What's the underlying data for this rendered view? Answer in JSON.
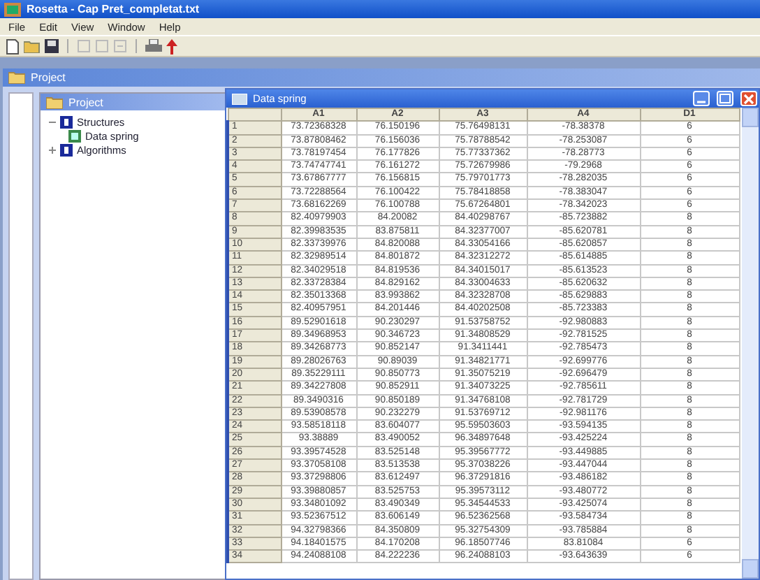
{
  "window": {
    "title": "Rosetta - Cap Pret_completat.txt"
  },
  "menu": [
    "File",
    "Edit",
    "View",
    "Window",
    "Help"
  ],
  "project_frame": {
    "title": "Project"
  },
  "project_tree": {
    "title": "Project",
    "items": [
      {
        "label": "Structures",
        "expanded": true,
        "children": [
          {
            "label": "Data spring"
          }
        ]
      },
      {
        "label": "Algorithms",
        "expanded": false
      }
    ]
  },
  "data_window": {
    "title": "Data spring"
  },
  "table": {
    "columns": [
      "A1",
      "A2",
      "A3",
      "A4",
      "D1"
    ],
    "rows": [
      {
        "index": "1",
        "cells": [
          "73.72368328",
          "76.150196",
          "75.76498131",
          "-78.38378",
          "6"
        ]
      },
      {
        "index": "2",
        "cells": [
          "73.87808462",
          "76.156036",
          "75.78788542",
          "-78.253087",
          "6"
        ]
      },
      {
        "index": "3",
        "cells": [
          "73.78197454",
          "76.177826",
          "75.77337362",
          "-78.28773",
          "6"
        ]
      },
      {
        "index": "4",
        "cells": [
          "73.74747741",
          "76.161272",
          "75.72679986",
          "-79.2968",
          "6"
        ]
      },
      {
        "index": "5",
        "cells": [
          "73.67867777",
          "76.156815",
          "75.79701773",
          "-78.282035",
          "6"
        ]
      },
      {
        "index": "6",
        "cells": [
          "73.72288564",
          "76.100422",
          "75.78418858",
          "-78.383047",
          "6"
        ]
      },
      {
        "index": "7",
        "cells": [
          "73.68162269",
          "76.100788",
          "75.67264801",
          "-78.342023",
          "6"
        ]
      },
      {
        "index": "8",
        "cells": [
          "82.40979903",
          "84.20082",
          "84.40298767",
          "-85.723882",
          "8"
        ]
      },
      {
        "index": "9",
        "cells": [
          "82.39983535",
          "83.875811",
          "84.32377007",
          "-85.620781",
          "8"
        ]
      },
      {
        "index": "10",
        "cells": [
          "82.33739976",
          "84.820088",
          "84.33054166",
          "-85.620857",
          "8"
        ]
      },
      {
        "index": "11",
        "cells": [
          "82.32989514",
          "84.801872",
          "84.32312272",
          "-85.614885",
          "8"
        ]
      },
      {
        "index": "12",
        "cells": [
          "82.34029518",
          "84.819536",
          "84.34015017",
          "-85.613523",
          "8"
        ]
      },
      {
        "index": "13",
        "cells": [
          "82.33728384",
          "84.829162",
          "84.33004633",
          "-85.620632",
          "8"
        ]
      },
      {
        "index": "14",
        "cells": [
          "82.35013368",
          "83.993862",
          "84.32328708",
          "-85.629883",
          "8"
        ]
      },
      {
        "index": "15",
        "cells": [
          "82.40957951",
          "84.201446",
          "84.40202508",
          "-85.723383",
          "8"
        ]
      },
      {
        "index": "16",
        "cells": [
          "89.52901618",
          "90.230297",
          "91.53758752",
          "-92.980883",
          "8"
        ]
      },
      {
        "index": "17",
        "cells": [
          "89.34968953",
          "90.346723",
          "91.34808529",
          "-92.781525",
          "8"
        ]
      },
      {
        "index": "18",
        "cells": [
          "89.34268773",
          "90.852147",
          "91.3411441",
          "-92.785473",
          "8"
        ]
      },
      {
        "index": "19",
        "cells": [
          "89.28026763",
          "90.89039",
          "91.34821771",
          "-92.699776",
          "8"
        ]
      },
      {
        "index": "20",
        "cells": [
          "89.35229111",
          "90.850773",
          "91.35075219",
          "-92.696479",
          "8"
        ]
      },
      {
        "index": "21",
        "cells": [
          "89.34227808",
          "90.852911",
          "91.34073225",
          "-92.785611",
          "8"
        ]
      },
      {
        "index": "22",
        "cells": [
          "89.3490316",
          "90.850189",
          "91.34768108",
          "-92.781729",
          "8"
        ]
      },
      {
        "index": "23",
        "cells": [
          "89.53908578",
          "90.232279",
          "91.53769712",
          "-92.981176",
          "8"
        ]
      },
      {
        "index": "24",
        "cells": [
          "93.58518118",
          "83.604077",
          "95.59503603",
          "-93.594135",
          "8"
        ]
      },
      {
        "index": "25",
        "cells": [
          "93.38889",
          "83.490052",
          "96.34897648",
          "-93.425224",
          "8"
        ]
      },
      {
        "index": "26",
        "cells": [
          "93.39574528",
          "83.525148",
          "95.39567772",
          "-93.449885",
          "8"
        ]
      },
      {
        "index": "27",
        "cells": [
          "93.37058108",
          "83.513538",
          "95.37038226",
          "-93.447044",
          "8"
        ]
      },
      {
        "index": "28",
        "cells": [
          "93.37298806",
          "83.612497",
          "96.37291816",
          "-93.486182",
          "8"
        ]
      },
      {
        "index": "29",
        "cells": [
          "93.39880857",
          "83.525753",
          "95.39573112",
          "-93.480772",
          "8"
        ]
      },
      {
        "index": "30",
        "cells": [
          "93.34801092",
          "83.490349",
          "95.34544533",
          "-93.425074",
          "8"
        ]
      },
      {
        "index": "31",
        "cells": [
          "93.52367512",
          "83.606149",
          "96.52362568",
          "-93.584734",
          "8"
        ]
      },
      {
        "index": "32",
        "cells": [
          "94.32798366",
          "84.350809",
          "95.32754309",
          "-93.785884",
          "8"
        ]
      },
      {
        "index": "33",
        "cells": [
          "94.18401575",
          "84.170208",
          "96.18507746",
          "83.81084",
          "6"
        ]
      },
      {
        "index": "34",
        "cells": [
          "94.24088108",
          "84.222236",
          "96.24088103",
          "-93.643639",
          "6"
        ]
      }
    ]
  }
}
